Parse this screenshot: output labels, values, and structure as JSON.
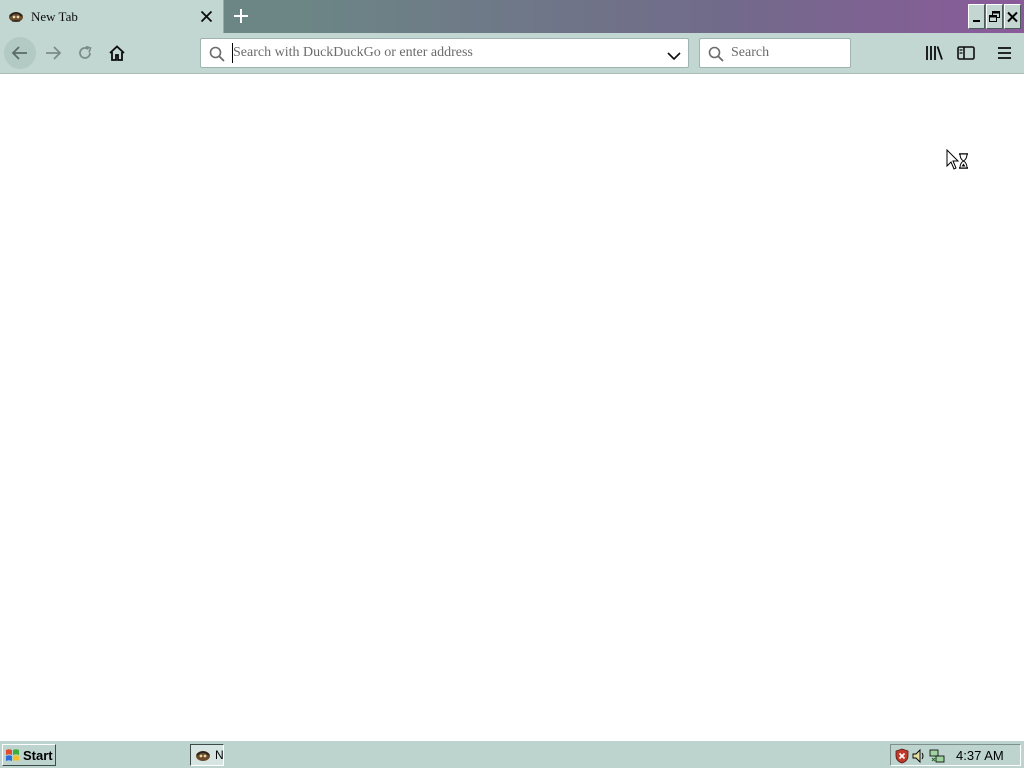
{
  "browser": {
    "tab": {
      "title": "New Tab",
      "favicon": "browser-globe-icon"
    },
    "window_controls": [
      "minimize-icon",
      "restore-icon",
      "close-icon"
    ],
    "toolbar": {
      "back_icon": "back-arrow-icon",
      "forward_icon": "forward-arrow-icon",
      "reload_icon": "reload-icon",
      "home_icon": "home-icon",
      "url_value": "",
      "url_placeholder": "Search with DuckDuckGo or enter address",
      "search_value": "",
      "search_placeholder": "Search",
      "library_icon": "library-icon",
      "sidebar_icon": "sidebar-icon",
      "menu_icon": "hamburger-menu-icon"
    }
  },
  "taskbar": {
    "start_label": "Start",
    "task_item_label": "N",
    "tray_icons": [
      "shield-alert-icon",
      "speaker-icon",
      "network-icon"
    ],
    "clock": "4:37 AM"
  },
  "colors": {
    "tab_active": "#c2d7d2",
    "toolbar": "#c2d7d2",
    "titlebar_left": "#6d8a86",
    "titlebar_right": "#8a5a9a",
    "taskbar": "#bdd3ce"
  }
}
